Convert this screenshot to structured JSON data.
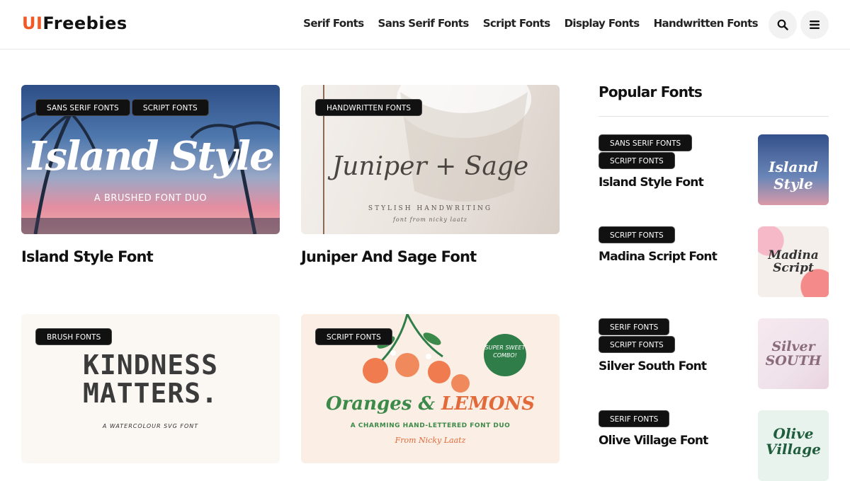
{
  "header": {
    "logo_ui": "UI",
    "logo_rest": "Freebies",
    "nav": [
      "Serif Fonts",
      "Sans Serif Fonts",
      "Script Fonts",
      "Display Fonts",
      "Handwritten Fonts"
    ],
    "search_icon": "search-icon",
    "menu_icon": "hamburger-menu-icon"
  },
  "cards": [
    {
      "title": "Island Style Font",
      "tags": [
        "SANS SERIF FONTS",
        "SCRIPT FONTS"
      ],
      "art": {
        "line1": "Island Style",
        "line2": "A BRUSHED FONT DUO"
      }
    },
    {
      "title": "Juniper And Sage Font",
      "tags": [
        "HANDWRITTEN FONTS"
      ],
      "art": {
        "line1": "Juniper + Sage",
        "line2": "STYLISH HANDWRITING",
        "line3": "font from nicky laatz"
      }
    },
    {
      "title": "",
      "tags": [
        "BRUSH FONTS"
      ],
      "art": {
        "line1": "KINDNESS",
        "line1b": "MATTERS.",
        "line2": "A WATERCOLOUR SVG FONT"
      }
    },
    {
      "title": "",
      "tags": [
        "SCRIPT FONTS"
      ],
      "art": {
        "line1": "Oranges &",
        "line1b": "LEMONS",
        "line2": "A CHARMING HAND-LETTERED FONT DUO",
        "line3": "From Nicky Laatz",
        "badge": "SUPER SWEET COMBO!"
      }
    }
  ],
  "sidebar": {
    "title": "Popular Fonts",
    "items": [
      {
        "tags": [
          "SANS SERIF FONTS",
          "SCRIPT FONTS"
        ],
        "title": "Island Style Font",
        "thumb_text": "Island Style"
      },
      {
        "tags": [
          "SCRIPT FONTS"
        ],
        "title": "Madina Script Font",
        "thumb_text": "Madina Script"
      },
      {
        "tags": [
          "SERIF FONTS",
          "SCRIPT FONTS"
        ],
        "title": "Silver South Font",
        "thumb_text": "Silver SOUTH"
      },
      {
        "tags": [
          "SERIF FONTS"
        ],
        "title": "Olive Village Font",
        "thumb_text": "Olive Village"
      }
    ]
  },
  "colors": {
    "accent": "#f15a24",
    "tag_bg": "#111111",
    "text": "#111111"
  }
}
